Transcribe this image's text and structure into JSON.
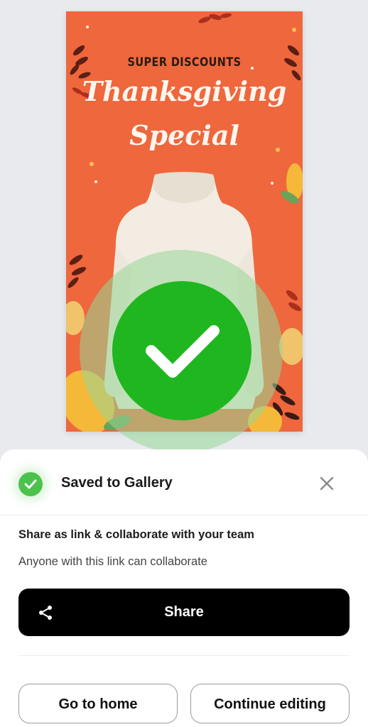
{
  "poster": {
    "kicker": "SUPER DISCOUNTS",
    "title_line1": "Thanksgiving",
    "title_line2": "Special",
    "background_color": "#ef673d"
  },
  "success": {
    "icon": "checkmark-icon",
    "color": "#1fb61f"
  },
  "sheet": {
    "saved_label": "Saved to Gallery",
    "close_icon": "close-icon",
    "share_heading": "Share as link & collaborate with your team",
    "share_sub": "Anyone with this link can collaborate",
    "share_button": "Share",
    "share_icon": "share-icon",
    "home_button": "Go to home",
    "continue_button": "Continue editing"
  }
}
